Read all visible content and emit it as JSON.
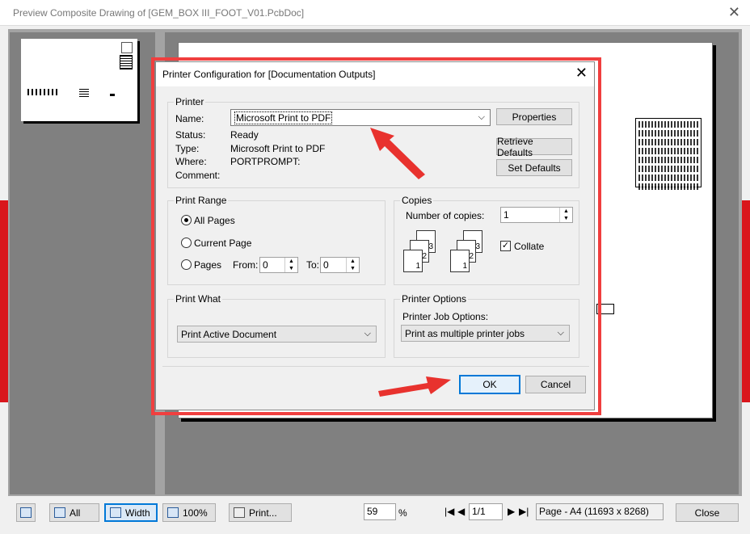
{
  "window": {
    "title": "Preview Composite Drawing of [GEM_BOX III_FOOT_V01.PcbDoc]",
    "close": "✕"
  },
  "dialog": {
    "title": "Printer Configuration for [Documentation Outputs]",
    "close": "✕",
    "printer": {
      "legend": "Printer",
      "name_label": "Name:",
      "name_value": "Microsoft Print to PDF",
      "status_label": "Status:",
      "status_value": "Ready",
      "type_label": "Type:",
      "type_value": "Microsoft Print to PDF",
      "where_label": "Where:",
      "where_value": "PORTPROMPT:",
      "comment_label": "Comment:",
      "properties": "Properties",
      "retrieve": "Retrieve Defaults",
      "set_defaults": "Set Defaults"
    },
    "range": {
      "legend": "Print Range",
      "all": "All Pages",
      "current": "Current Page",
      "pages": "Pages",
      "from_label": "From:",
      "from_value": "0",
      "to_label": "To:",
      "to_value": "0"
    },
    "copies": {
      "legend": "Copies",
      "number_label": "Number of copies:",
      "number_value": "1",
      "collate": "Collate",
      "stack_nums": [
        "3",
        "2",
        "1"
      ]
    },
    "what": {
      "legend": "Print What",
      "value": "Print Active Document"
    },
    "options": {
      "legend": "Printer Options",
      "job_label": "Printer Job Options:",
      "job_value": "Print as multiple printer jobs"
    },
    "ok": "OK",
    "cancel": "Cancel"
  },
  "toolbar": {
    "all": "All",
    "width": "Width",
    "zoom100": "100%",
    "print": "Print...",
    "zoom_value": "59",
    "zoom_unit": "%",
    "page_value": "1/1",
    "page_info": "Page - A4 (11693 x 8268)",
    "close": "Close"
  },
  "colors": {
    "accent": "#0078d7",
    "highlight": "#f03f3f",
    "pcb_red": "#d9161c"
  }
}
